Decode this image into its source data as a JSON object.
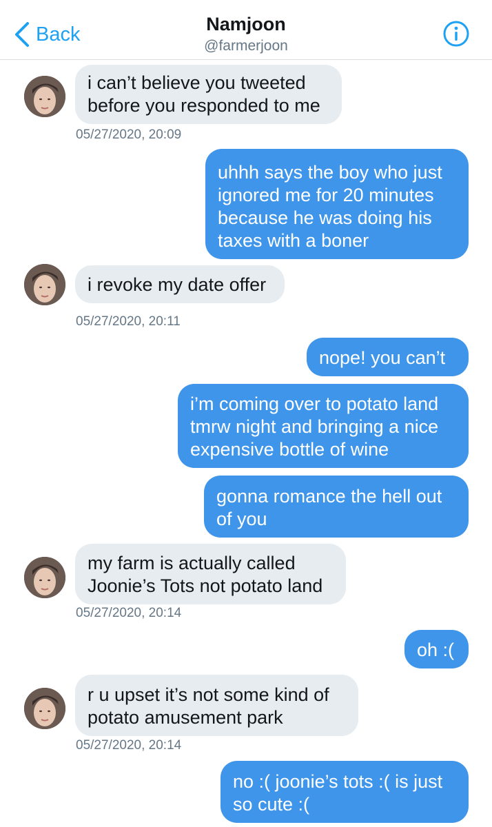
{
  "header": {
    "back_label": "Back",
    "title": "Namjoon",
    "handle": "@farmerjoon",
    "back_icon": "chevron-left-icon",
    "info_icon": "info-circle-icon"
  },
  "colors": {
    "accent": "#1da1f2",
    "outgoing_bubble": "#3f95ea",
    "incoming_bubble": "#e6ecf0"
  },
  "messages": [
    {
      "from": "them",
      "lines": [
        "i can’t believe you tweeted",
        "before you responded to me"
      ]
    },
    {
      "ts": "05/27/2020, 20:09"
    },
    {
      "from": "me",
      "lines": [
        "uhhh says the boy who just",
        "ignored me for 20 minutes",
        "because he was doing his",
        "taxes with a boner"
      ]
    },
    {
      "from": "them",
      "lines": [
        "i revoke my date offer"
      ]
    },
    {
      "ts": "05/27/2020, 20:11"
    },
    {
      "from": "me",
      "lines": [
        "nope! you can’t"
      ]
    },
    {
      "from": "me",
      "lines": [
        "i’m coming over to potato land",
        "tmrw night and bringing a nice",
        "expensive bottle of wine"
      ]
    },
    {
      "from": "me",
      "lines": [
        "gonna romance the hell out",
        "of you"
      ]
    },
    {
      "from": "them",
      "lines": [
        "my farm is actually called",
        "Joonie’s Tots not potato land"
      ]
    },
    {
      "ts": "05/27/2020, 20:14"
    },
    {
      "from": "me",
      "lines": [
        "oh :("
      ]
    },
    {
      "from": "them",
      "lines": [
        "r u upset it’s not some kind of",
        "potato amusement park"
      ]
    },
    {
      "ts": "05/27/2020, 20:14"
    },
    {
      "from": "me",
      "lines": [
        "no :( joonie’s tots :( is just",
        "so cute :("
      ]
    }
  ]
}
